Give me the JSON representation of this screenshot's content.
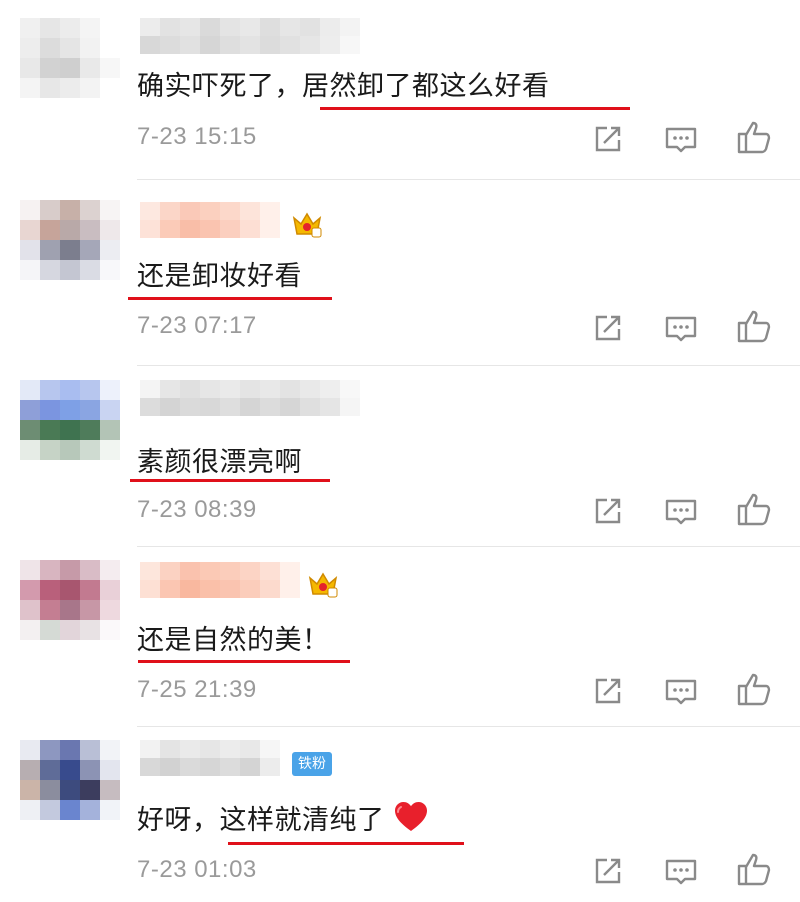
{
  "comments": [
    {
      "text": "确实吓死了，居然卸了都这么好看",
      "time": "7-23 15:15",
      "avatar": [
        "#f0f0f0",
        "#e6e6e6",
        "#ececec",
        "#f4f4f4",
        "#ffffff",
        "#ededed",
        "#dcdcdc",
        "#e5e5e5",
        "#f2f2f2",
        "#ffffff",
        "#e8e8e8",
        "#d2d2d2",
        "#cfcfcf",
        "#e9e9e9",
        "#f7f7f7",
        "#f4f4f4",
        "#e7e7e7",
        "#ececec",
        "#f3f3f3",
        "#ffffff"
      ]
    },
    {
      "text": "还是卸妆好看",
      "time": "7-23 07:17",
      "avatar": [
        "#f6f2f2",
        "#d8ccca",
        "#c7b0a8",
        "#dcd2d0",
        "#f7f4f4",
        "#e8d6d2",
        "#c6a49a",
        "#b9a9a8",
        "#c9bdc1",
        "#eee8ea",
        "#e2e2ea",
        "#9fa1b0",
        "#7c7e8e",
        "#a5a7b8",
        "#ecedf2",
        "#f5f5f8",
        "#d6d7e0",
        "#c4c6d2",
        "#dadce4",
        "#f8f8fa"
      ]
    },
    {
      "text": "素颜很漂亮啊",
      "time": "7-23 08:39",
      "avatar": [
        "#e3e9f7",
        "#b7c6ee",
        "#a9bdf0",
        "#b7c6ee",
        "#edf1fb",
        "#8e9fd8",
        "#7b95e0",
        "#7ea0e6",
        "#8aa5e2",
        "#c9d4f2",
        "#6d8d73",
        "#4a7a55",
        "#3f7350",
        "#4f7c5b",
        "#b3c4b6",
        "#e6ece6",
        "#c6d3c6",
        "#b7c8ba",
        "#cfdbd1",
        "#f1f5f1"
      ]
    },
    {
      "text": "还是自然的美！",
      "time": "7-25 21:39",
      "avatar": [
        "#efe4e8",
        "#d8b5c0",
        "#c69aa8",
        "#d9bcc6",
        "#f4ecef",
        "#d39aad",
        "#b9607b",
        "#a8566f",
        "#c27a90",
        "#e9d0d8",
        "#dfc2cb",
        "#c47e92",
        "#a8768a",
        "#c797a6",
        "#eed9df",
        "#f3f0f1",
        "#d5dad5",
        "#e2d5da",
        "#e8e2e4",
        "#fbf9fa"
      ]
    },
    {
      "text_before": "好呀，",
      "text": "这样就清纯了",
      "time": "7-23 01:03",
      "fan_badge": "铁粉",
      "avatar": [
        "#e8eaf1",
        "#8d97c0",
        "#6a77b0",
        "#b9bfd6",
        "#f2f3f7",
        "#b7aeb1",
        "#5f6c98",
        "#384b8d",
        "#8c93b4",
        "#e3e5ee",
        "#cbb4a8",
        "#8b8d9e",
        "#3d4b7e",
        "#3c3d5e",
        "#c6bcc0",
        "#eef0f4",
        "#c3c9de",
        "#6a85cf",
        "#a4b2db",
        "#f1f3f8"
      ]
    }
  ],
  "icons": {
    "share": "share-icon",
    "comment": "comment-icon",
    "like": "thumbs-up-icon"
  },
  "colors": {
    "underline": "#e0101a",
    "time": "#9a9a9a",
    "fan_badge": "#4aa3e8",
    "crown": "#f5b800"
  }
}
